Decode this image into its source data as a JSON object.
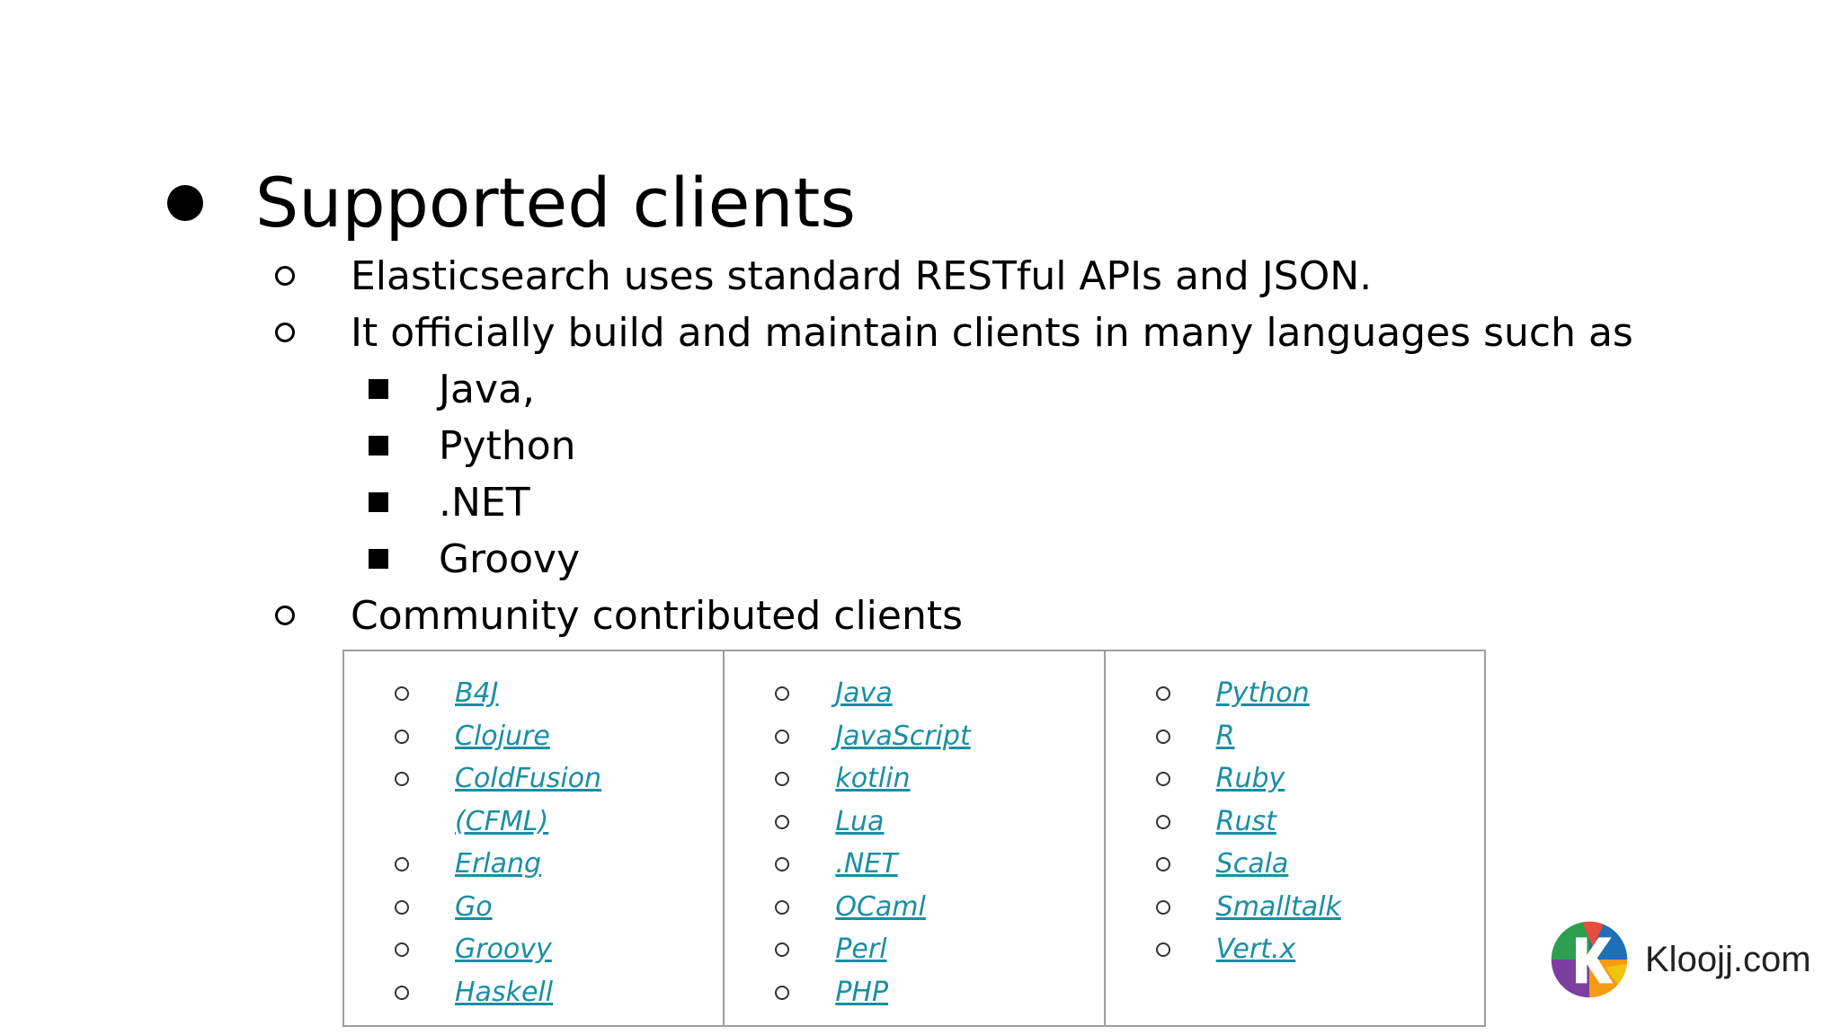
{
  "title": "Supported clients",
  "points": [
    "Elasticsearch uses standard RESTful APIs and JSON.",
    "It officially build and maintain clients in many languages such as",
    "Community contributed clients"
  ],
  "official_languages": [
    "Java,",
    "Python",
    ".NET",
    "Groovy"
  ],
  "community_clients": {
    "col1": [
      "B4J",
      "Clojure",
      "ColdFusion",
      "(CFML)",
      "Erlang",
      "Go",
      "Groovy",
      "Haskell"
    ],
    "col2": [
      "Java",
      "JavaScript",
      "kotlin",
      "Lua",
      ".NET",
      "OCaml",
      "Perl",
      "PHP"
    ],
    "col3": [
      "Python",
      "R",
      "Ruby",
      "Rust",
      "Scala",
      "Smalltalk",
      "Vert.x"
    ]
  },
  "logo": {
    "text": "Kloojj.com",
    "icon": "kloojj-k-logo-icon"
  },
  "colors": {
    "link": "#1a8ea3",
    "table_border": "#9e9e9e"
  }
}
